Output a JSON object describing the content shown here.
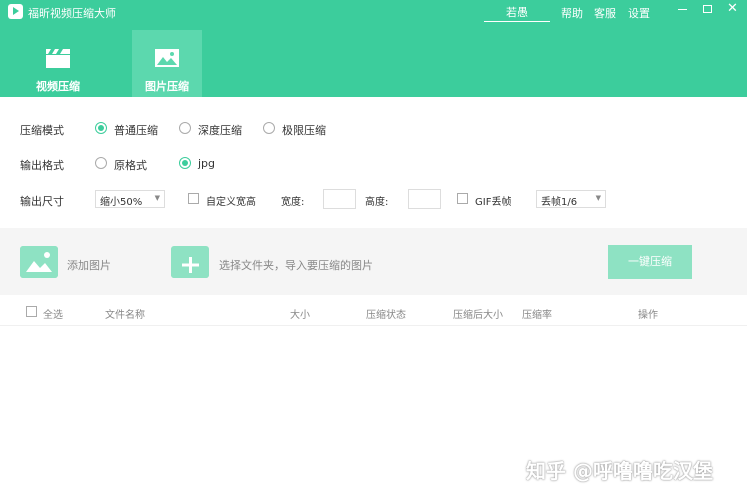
{
  "window": {
    "title": "福昕视频压缩大师",
    "username": "若愚",
    "links": [
      "帮助",
      "客服",
      "设置"
    ],
    "min_icon": "minimize-icon",
    "max_icon": "maximize-icon",
    "close_icon": "close-icon",
    "close_glyph": "✕"
  },
  "tabs": [
    {
      "label": "视频压缩",
      "icon": "video-clapper-icon",
      "active": false
    },
    {
      "label": "图片压缩",
      "icon": "image-icon",
      "active": true
    }
  ],
  "options": {
    "mode": {
      "label": "压缩模式",
      "choices": [
        "普通压缩",
        "深度压缩",
        "极限压缩"
      ],
      "selected": "普通压缩"
    },
    "format": {
      "label": "输出格式",
      "choices": [
        "原格式",
        "jpg"
      ],
      "selected": "jpg"
    },
    "size": {
      "label": "输出尺寸",
      "scale_value": "缩小50%",
      "custom_label": "自定义宽高",
      "width_label": "宽度:",
      "height_label": "高度:",
      "gif_label": "GIF丢帧",
      "gif_value": "丢帧1/6",
      "dropdown_glyph": "▼"
    }
  },
  "drop_area": {
    "add_image": "添加图片",
    "select_folder": "选择文件夹，导入要压缩的图片",
    "compress_button": "一键压缩"
  },
  "table": {
    "select_all": "全选",
    "columns": [
      "文件名称",
      "大小",
      "压缩状态",
      "压缩后大小",
      "压缩率",
      "操作"
    ]
  },
  "watermark": "知乎 @呼噜噜吃汉堡",
  "colors": {
    "accent": "#3ccd9c",
    "accent_light": "#8ee2c3",
    "tab_active": "#5cd8ae"
  }
}
